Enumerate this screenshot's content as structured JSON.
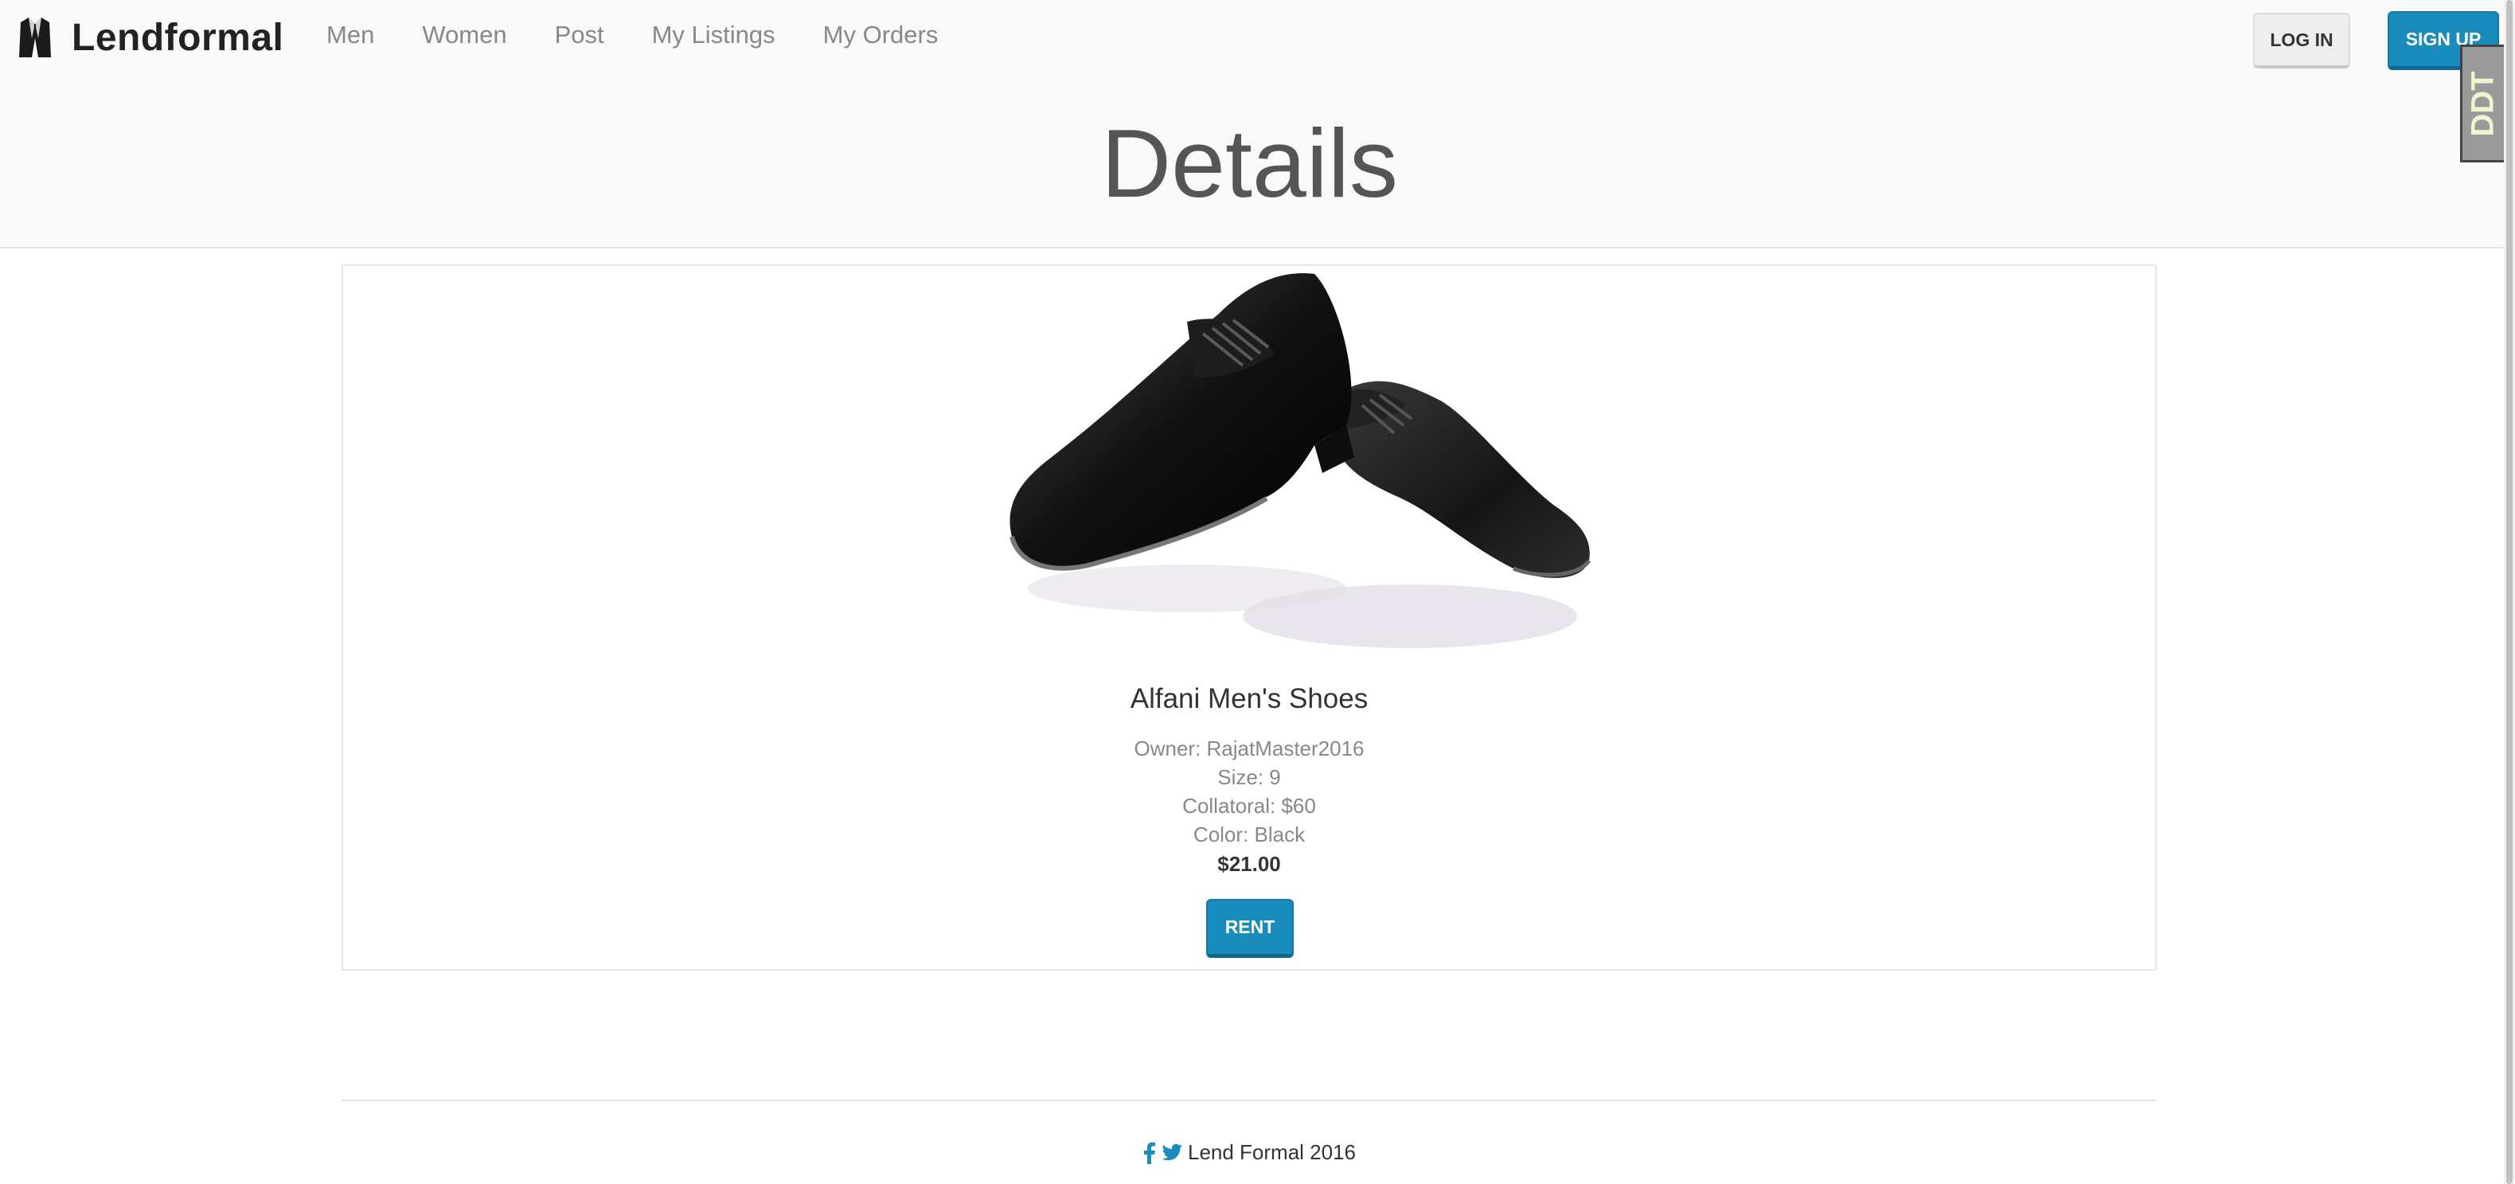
{
  "brand": {
    "name": "Lendformal",
    "logo_icon": "jacket-icon"
  },
  "nav": {
    "items": [
      {
        "label": "Men"
      },
      {
        "label": "Women"
      },
      {
        "label": "Post"
      },
      {
        "label": "My Listings"
      },
      {
        "label": "My Orders"
      }
    ]
  },
  "auth": {
    "login_label": "LOG IN",
    "signup_label": "SIGN UP"
  },
  "extension_badge": {
    "label": "DDT"
  },
  "page": {
    "title": "Details"
  },
  "product": {
    "image_icon": "shoes-image",
    "name": "Alfani Men's Shoes",
    "owner": "Owner: RajatMaster2016",
    "size": "Size: 9",
    "collateral": "Collatoral: $60",
    "color": "Color: Black",
    "price": "$21.00",
    "rent_label": "RENT"
  },
  "footer": {
    "text": "Lend Formal 2016",
    "icons": [
      "facebook-icon",
      "twitter-icon"
    ]
  },
  "colors": {
    "primary": "#1a8bbd",
    "header_bg": "#f9f9f9",
    "muted_text": "#888888"
  }
}
